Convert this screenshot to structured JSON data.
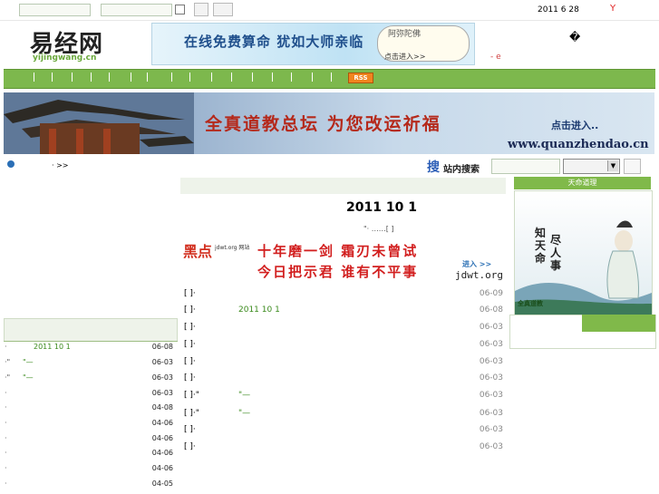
{
  "topbar": {
    "date": "2011 6 28",
    "mark": "Y"
  },
  "logo": {
    "text": "易经网",
    "sub": "yijingwang.cn"
  },
  "banner1": {
    "text": "在线免费算命  犹如大师亲临",
    "badge": "阿弥陀佛",
    "enter": "点击进入>>"
  },
  "header": {
    "glyph": "�",
    "mark": "- e"
  },
  "nav": {
    "rss": "RSS"
  },
  "banner2": {
    "title": "全真道教总坛  为您改运祈福",
    "click": "点击进入..",
    "url": "www.quanzhendao.cn"
  },
  "location": {
    "text": "· >>"
  },
  "search": {
    "icon": "搜",
    "label": "站内搜索"
  },
  "article": {
    "date": "2011  10  1",
    "meta": "\"·       ……[ ]"
  },
  "ad": {
    "logo": "黑点",
    "sub": "jdwt.org 网站",
    "line1": "十年磨一剑  霜刃未曾试",
    "line2": "今日把示君  谁有不平事",
    "enter": "进入 >>",
    "url": "jdwt.org"
  },
  "center_list": [
    {
      "bracket": "[ ]·",
      "title": "",
      "date": "06-09"
    },
    {
      "bracket": "[    ]·",
      "title": "2011 10 1",
      "date": "06-08"
    },
    {
      "bracket": "[      ]·",
      "title": "",
      "date": "06-03"
    },
    {
      "bracket": "[ ]·",
      "title": "",
      "date": "06-03"
    },
    {
      "bracket": "[ ]·",
      "title": "",
      "date": "06-03"
    },
    {
      "bracket": "[ ]·",
      "title": "",
      "date": "06-03"
    },
    {
      "bracket": "[ ]·\"",
      "title": "  \"—",
      "date": "06-03"
    },
    {
      "bracket": "[ ]·\"",
      "title": "\"—",
      "date": "06-03"
    },
    {
      "bracket": "[      ]·",
      "title": "",
      "date": "06-03"
    },
    {
      "bracket": "[      ]·",
      "title": "",
      "date": "06-03"
    }
  ],
  "left_list": [
    {
      "mark": "·",
      "title": "2011 10 1",
      "date": "06-08"
    },
    {
      "mark": "·\"",
      "title": "\"—",
      "date": "06-03"
    },
    {
      "mark": "·\"",
      "title": "\"—",
      "date": "06-03"
    },
    {
      "mark": "·",
      "title": "",
      "date": "06-03"
    },
    {
      "mark": "·",
      "title": "",
      "date": "04-08"
    },
    {
      "mark": "·",
      "title": "",
      "date": "04-06"
    },
    {
      "mark": "·",
      "title": "",
      "date": "04-06"
    },
    {
      "mark": "·",
      "title": "",
      "date": "04-06"
    },
    {
      "mark": "·",
      "title": "",
      "date": "04-06"
    },
    {
      "mark": "·",
      "title": "",
      "date": "04-05"
    }
  ],
  "right": {
    "title": "天命道理",
    "cal1": "知天命",
    "cal2": "尽人事",
    "footer": "全真道教"
  },
  "colors": {
    "green": "#80b94a",
    "nav_green": "#7db84d",
    "link_green": "#3a8a1c",
    "red": "#d21f1f"
  }
}
